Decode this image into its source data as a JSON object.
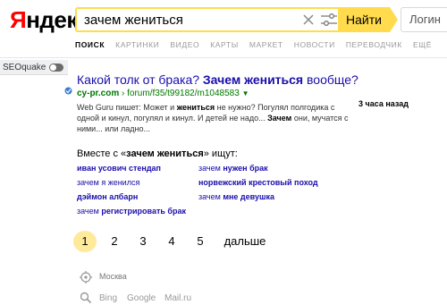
{
  "logo": {
    "first": "Я",
    "rest": "ндекс"
  },
  "search": {
    "query": "зачем жениться",
    "button_label": "Найти"
  },
  "login_label": "Логин",
  "tabs": [
    "ПОИСК",
    "КАРТИНКИ",
    "ВИДЕО",
    "КАРТЫ",
    "МАРКЕТ",
    "НОВОСТИ",
    "ПЕРЕВОДЧИК",
    "ЕЩЁ"
  ],
  "seoquake": {
    "label": "SEOquake",
    "enabled": false
  },
  "result": {
    "title_pre": "Какой толк от брака? ",
    "title_bold": "Зачем жениться",
    "title_post": " вообще?",
    "host": "cy-pr.com",
    "path": " › forum/f35/t99182/m1048583",
    "arrow": "▼",
    "snippet": [
      {
        "text": "Web Guru пишет: Может и ",
        "bold": false
      },
      {
        "text": "жениться",
        "bold": true
      },
      {
        "text": " не нужно? Погулял полгодика с одной и кинул, погулял и кинул. И детей не надо... ",
        "bold": false
      },
      {
        "text": "Зачем",
        "bold": true
      },
      {
        "text": " они, мучатся с ними... или ладно...",
        "bold": false
      }
    ],
    "time": "3 часа назад"
  },
  "related": {
    "head_pre": "Вместе с «",
    "head_bold": "зачем жениться",
    "head_post": "» ищут:",
    "items": [
      {
        "plain": "",
        "bold": "иван усович стендап"
      },
      {
        "plain": "зачем ",
        "bold": "нужен брак"
      },
      {
        "plain": "зачем я женился",
        "bold": ""
      },
      {
        "plain": "",
        "bold": "норвежский крестовый поход"
      },
      {
        "plain": "",
        "bold": "дэймон албарн"
      },
      {
        "plain": "зачем ",
        "bold": "мне девушка"
      },
      {
        "plain": "зачем ",
        "bold": "регистрировать брак"
      }
    ]
  },
  "pager": {
    "pages": [
      "1",
      "2",
      "3",
      "4",
      "5"
    ],
    "current": "1",
    "next_label": "дальше"
  },
  "footer": {
    "location": "Москва",
    "engines": [
      "Bing",
      "Google",
      "Mail.ru"
    ]
  },
  "colors": {
    "brand_yellow": "#ffdb4d",
    "link": "#1a0dab",
    "url_green": "#007700",
    "logo_red": "#ff0000",
    "current_page": "#ffe99b"
  }
}
